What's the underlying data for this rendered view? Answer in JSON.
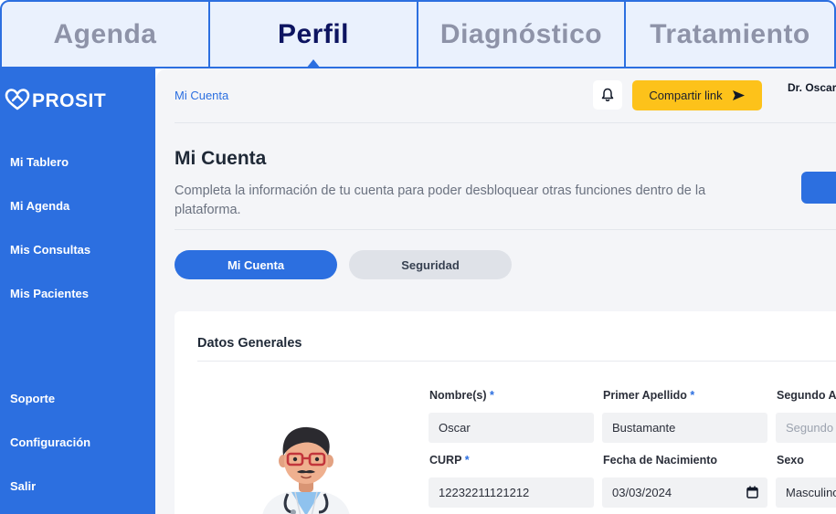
{
  "tabs": [
    {
      "label": "Agenda",
      "active": false
    },
    {
      "label": "Perfil",
      "active": true
    },
    {
      "label": "Diagnóstico",
      "active": false
    },
    {
      "label": "Tratamiento",
      "active": false
    }
  ],
  "brand": {
    "name": "PROSIT",
    "logo_icon": "heart-loop-icon"
  },
  "sidebar": {
    "items": [
      {
        "label": "Mi Tablero"
      },
      {
        "label": "Mi Agenda"
      },
      {
        "label": "Mis Consultas"
      },
      {
        "label": "Mis Pacientes"
      },
      {
        "label": "Soporte"
      },
      {
        "label": "Configuración"
      },
      {
        "label": "Salir"
      }
    ]
  },
  "header": {
    "breadcrumb": "Mi Cuenta",
    "notification_icon": "bell-icon",
    "share_label": "Compartir link",
    "share_icon": "send-arrow-icon",
    "user_name": "Dr. Oscar"
  },
  "page": {
    "title": "Mi Cuenta",
    "description": "Completa la información de tu cuenta para poder desbloquear otras funciones dentro de la plataforma."
  },
  "subtabs": [
    {
      "label": "Mi Cuenta",
      "active": true
    },
    {
      "label": "Seguridad",
      "active": false
    }
  ],
  "card": {
    "title": "Datos Generales",
    "fields": {
      "nombre": {
        "label": "Nombre(s)",
        "required": "*",
        "value": "Oscar"
      },
      "primer_apellido": {
        "label": "Primer Apellido",
        "required": "*",
        "value": "Bustamante"
      },
      "segundo_apellido": {
        "label": "Segundo Apellido",
        "placeholder": "Segundo Apellido"
      },
      "curp": {
        "label": "CURP",
        "required": "*",
        "value": "12232211121212"
      },
      "fecha_nacimiento": {
        "label": "Fecha de Nacimiento",
        "value": "03/03/2024",
        "icon": "calendar-icon"
      },
      "sexo": {
        "label": "Sexo",
        "value": "Masculino"
      }
    }
  },
  "colors": {
    "primary": "#2c6fe0",
    "accent": "#fdc21a",
    "tab_background": "#eaf1fd",
    "active_tab_text": "#0d1460",
    "inactive_tab_text": "#8e93a8"
  }
}
